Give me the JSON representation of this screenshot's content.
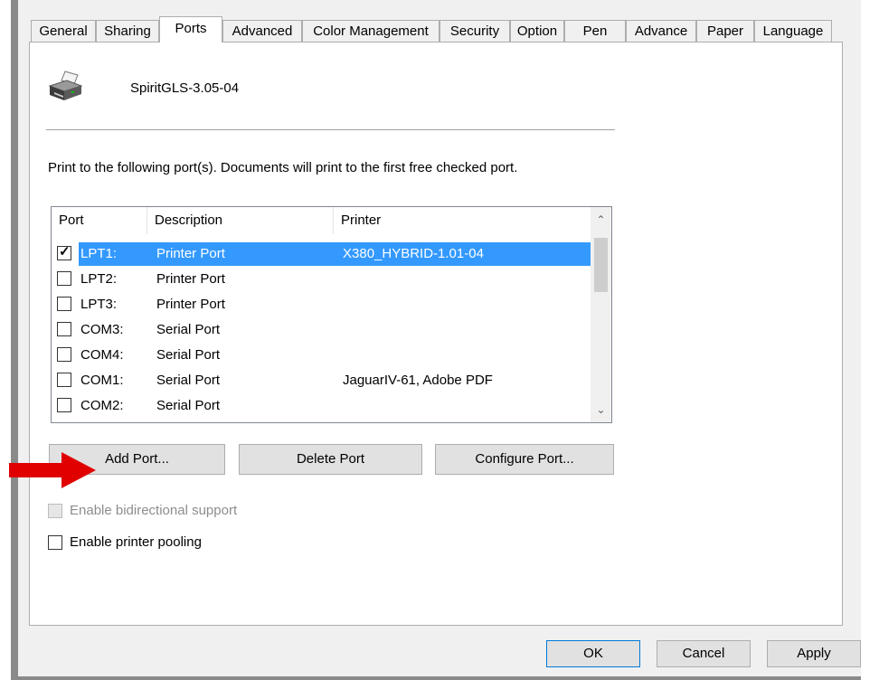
{
  "tabs": [
    "General",
    "Sharing",
    "Ports",
    "Advanced",
    "Color Management",
    "Security",
    "Option",
    "Pen",
    "Advance",
    "Paper",
    "Language"
  ],
  "active_tab": "Ports",
  "printer": {
    "name": "SpiritGLS-3.05-04",
    "icon": "printer-icon"
  },
  "description": "Print to the following port(s). Documents will print to the first free checked port.",
  "list": {
    "headers": {
      "port": "Port",
      "description": "Description",
      "printer": "Printer"
    },
    "rows": [
      {
        "port": "LPT1:",
        "description": "Printer Port",
        "printer": "X380_HYBRID-1.01-04",
        "checked": true,
        "selected": true
      },
      {
        "port": "LPT2:",
        "description": "Printer Port",
        "printer": "",
        "checked": false,
        "selected": false
      },
      {
        "port": "LPT3:",
        "description": "Printer Port",
        "printer": "",
        "checked": false,
        "selected": false
      },
      {
        "port": "COM3:",
        "description": "Serial Port",
        "printer": "",
        "checked": false,
        "selected": false
      },
      {
        "port": "COM4:",
        "description": "Serial Port",
        "printer": "",
        "checked": false,
        "selected": false
      },
      {
        "port": "COM1:",
        "description": "Serial Port",
        "printer": "JaguarIV-61, Adobe PDF",
        "checked": false,
        "selected": false
      },
      {
        "port": "COM2:",
        "description": "Serial Port",
        "printer": "",
        "checked": false,
        "selected": false
      }
    ]
  },
  "buttons": {
    "add_port": "Add Port...",
    "delete_port": "Delete Port",
    "configure_port": "Configure Port..."
  },
  "options": {
    "bidirectional": {
      "label": "Enable bidirectional support",
      "checked": false,
      "enabled": false
    },
    "pooling": {
      "label": "Enable printer pooling",
      "checked": false,
      "enabled": true
    }
  },
  "dialog_buttons": {
    "ok": "OK",
    "cancel": "Cancel",
    "apply": "Apply"
  },
  "colors": {
    "selection": "#3399ff",
    "arrow": "#e00000"
  }
}
